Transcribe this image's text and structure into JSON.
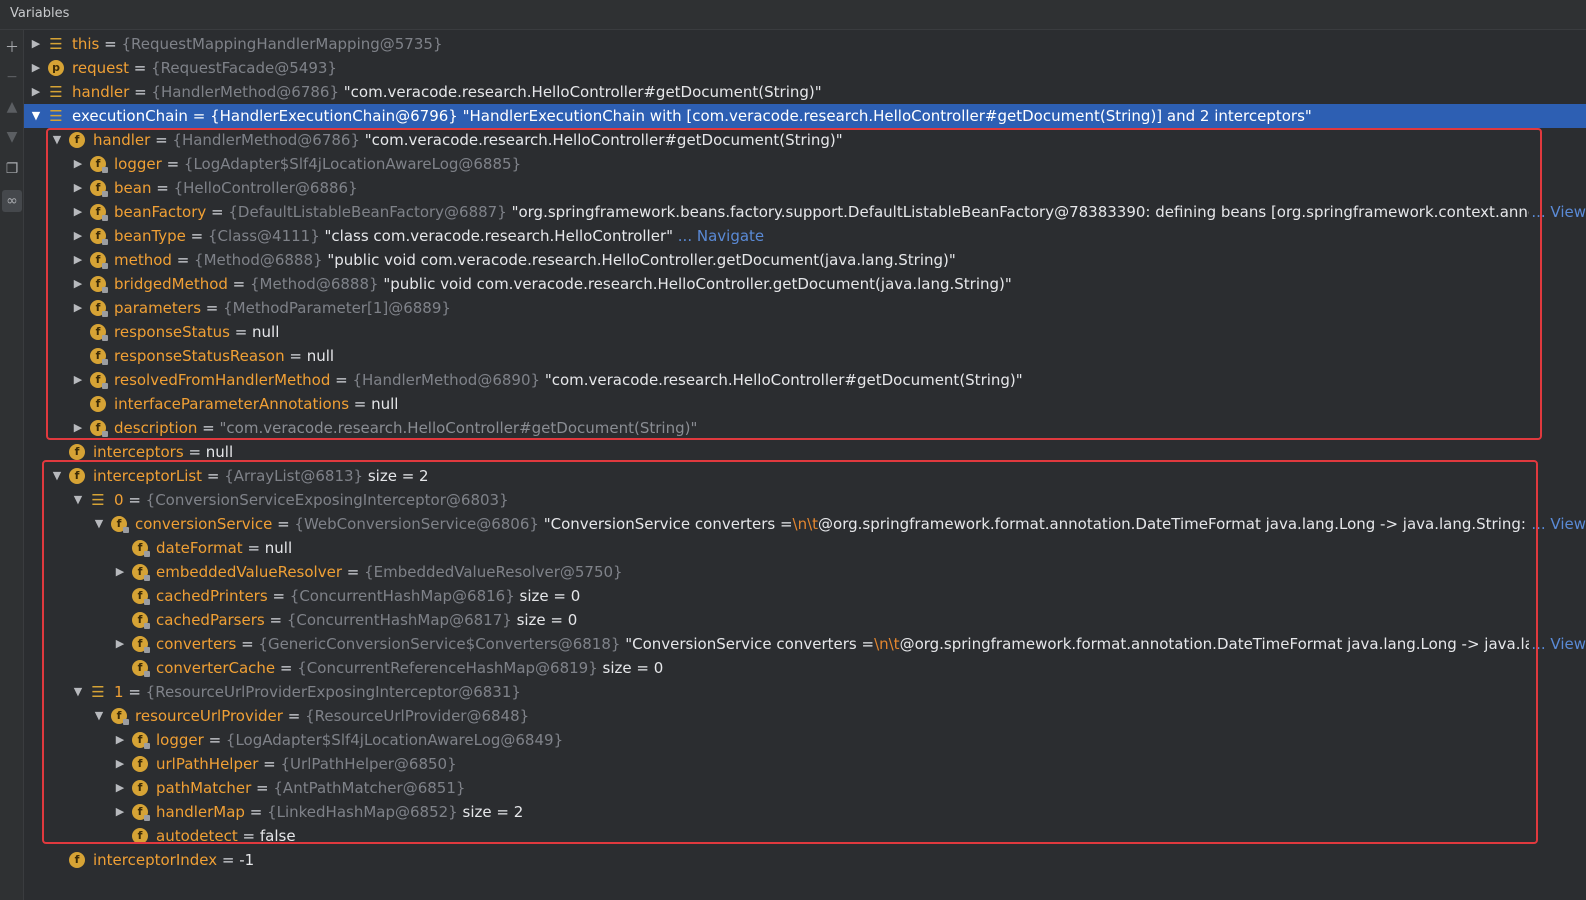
{
  "panel": {
    "title": "Variables"
  },
  "toolbar": {
    "icons": [
      "plus-icon",
      "minus-icon",
      "up-icon",
      "down-icon",
      "copy-icon",
      "watch-glasses-icon"
    ]
  },
  "rows": [
    {
      "depth": 0,
      "exp": "collapsed",
      "icon": "stack",
      "name": "this",
      "type": "{RequestMappingHandlerMapping@5735}",
      "value": "",
      "extra": ""
    },
    {
      "depth": 0,
      "exp": "collapsed",
      "icon": "param",
      "name": "request",
      "type": "{RequestFacade@5493}",
      "value": "",
      "extra": ""
    },
    {
      "depth": 0,
      "exp": "collapsed",
      "icon": "stack",
      "name": "handler",
      "type": "{HandlerMethod@6786}",
      "value": "\"com.veracode.research.HelloController#getDocument(String)\"",
      "extra": ""
    },
    {
      "depth": 0,
      "exp": "expanded",
      "icon": "stack",
      "name": "executionChain",
      "type": "{HandlerExecutionChain@6796}",
      "value": "\"HandlerExecutionChain with [com.veracode.research.HelloController#getDocument(String)] and 2 interceptors\"",
      "extra": "",
      "selected": true
    },
    {
      "depth": 1,
      "exp": "expanded",
      "icon": "field",
      "name": "handler",
      "type": "{HandlerMethod@6786}",
      "value": "\"com.veracode.research.HelloController#getDocument(String)\"",
      "extra": ""
    },
    {
      "depth": 2,
      "exp": "collapsed",
      "icon": "field-lock",
      "name": "logger",
      "type": "{LogAdapter$Slf4jLocationAwareLog@6885}",
      "value": "",
      "extra": ""
    },
    {
      "depth": 2,
      "exp": "collapsed",
      "icon": "field-lock",
      "name": "bean",
      "type": "{HelloController@6886}",
      "value": "",
      "extra": ""
    },
    {
      "depth": 2,
      "exp": "collapsed",
      "icon": "field-lock",
      "name": "beanFactory",
      "type": "{DefaultListableBeanFactory@6887}",
      "value": "\"org.springframework.beans.factory.support.DefaultListableBeanFactory@78383390: defining beans [org.springframework.context.annc",
      "extra": "",
      "view": "... View"
    },
    {
      "depth": 2,
      "exp": "collapsed",
      "icon": "field-lock",
      "name": "beanType",
      "type": "{Class@4111}",
      "value": "\"class com.veracode.research.HelloController\"",
      "extra": "",
      "link": "... Navigate"
    },
    {
      "depth": 2,
      "exp": "collapsed",
      "icon": "field-lock",
      "name": "method",
      "type": "{Method@6888}",
      "value": "\"public void com.veracode.research.HelloController.getDocument(java.lang.String)\"",
      "extra": ""
    },
    {
      "depth": 2,
      "exp": "collapsed",
      "icon": "field-lock",
      "name": "bridgedMethod",
      "type": "{Method@6888}",
      "value": "\"public void com.veracode.research.HelloController.getDocument(java.lang.String)\"",
      "extra": ""
    },
    {
      "depth": 2,
      "exp": "collapsed",
      "icon": "field-lock",
      "name": "parameters",
      "type": "{MethodParameter[1]@6889}",
      "value": "",
      "extra": ""
    },
    {
      "depth": 2,
      "exp": "none",
      "icon": "field-lock",
      "name": "responseStatus",
      "type": "",
      "value": "null",
      "extra": ""
    },
    {
      "depth": 2,
      "exp": "none",
      "icon": "field-lock",
      "name": "responseStatusReason",
      "type": "",
      "value": "null",
      "extra": ""
    },
    {
      "depth": 2,
      "exp": "collapsed",
      "icon": "field-lock",
      "name": "resolvedFromHandlerMethod",
      "type": "{HandlerMethod@6890}",
      "value": "\"com.veracode.research.HelloController#getDocument(String)\"",
      "extra": ""
    },
    {
      "depth": 2,
      "exp": "none",
      "icon": "field",
      "name": "interfaceParameterAnnotations",
      "type": "",
      "value": "null",
      "extra": ""
    },
    {
      "depth": 2,
      "exp": "collapsed",
      "icon": "field-lock",
      "name": "description",
      "type": "",
      "value": "\"com.veracode.research.HelloController#getDocument(String)\"",
      "extra": "",
      "dimvalue": true
    },
    {
      "depth": 1,
      "exp": "none",
      "icon": "field",
      "name": "interceptors",
      "type": "",
      "value": "null",
      "extra": ""
    },
    {
      "depth": 1,
      "exp": "expanded",
      "icon": "field",
      "name": "interceptorList",
      "type": "{ArrayList@6813}",
      "value": "",
      "extra": "size = 2"
    },
    {
      "depth": 2,
      "exp": "expanded",
      "icon": "stack",
      "name": "0",
      "type": "{ConversionServiceExposingInterceptor@6803}",
      "value": "",
      "extra": ""
    },
    {
      "depth": 3,
      "exp": "expanded",
      "icon": "field-lock",
      "name": "conversionService",
      "type": "{WebConversionService@6806}",
      "value": "\"ConversionService converters =\\n\\t@org.springframework.format.annotation.DateTimeFormat java.lang.Long -> java.lang.String: or",
      "extra": "",
      "view": "... View",
      "esc": true
    },
    {
      "depth": 4,
      "exp": "none",
      "icon": "field-lock",
      "name": "dateFormat",
      "type": "",
      "value": "null",
      "extra": ""
    },
    {
      "depth": 4,
      "exp": "collapsed",
      "icon": "field-lock",
      "name": "embeddedValueResolver",
      "type": "{EmbeddedValueResolver@5750}",
      "value": "",
      "extra": ""
    },
    {
      "depth": 4,
      "exp": "none",
      "icon": "field-lock",
      "name": "cachedPrinters",
      "type": "{ConcurrentHashMap@6816}",
      "value": "",
      "extra": "size = 0"
    },
    {
      "depth": 4,
      "exp": "none",
      "icon": "field-lock",
      "name": "cachedParsers",
      "type": "{ConcurrentHashMap@6817}",
      "value": "",
      "extra": "size = 0"
    },
    {
      "depth": 4,
      "exp": "collapsed",
      "icon": "field-lock",
      "name": "converters",
      "type": "{GenericConversionService$Converters@6818}",
      "value": "\"ConversionService converters =\\n\\t@org.springframework.format.annotation.DateTimeFormat java.lang.Long -> java.lang",
      "extra": "",
      "view": "... View",
      "esc": true
    },
    {
      "depth": 4,
      "exp": "none",
      "icon": "field-lock",
      "name": "converterCache",
      "type": "{ConcurrentReferenceHashMap@6819}",
      "value": "",
      "extra": "size = 0"
    },
    {
      "depth": 2,
      "exp": "expanded",
      "icon": "stack",
      "name": "1",
      "type": "{ResourceUrlProviderExposingInterceptor@6831}",
      "value": "",
      "extra": ""
    },
    {
      "depth": 3,
      "exp": "expanded",
      "icon": "field-lock",
      "name": "resourceUrlProvider",
      "type": "{ResourceUrlProvider@6848}",
      "value": "",
      "extra": ""
    },
    {
      "depth": 4,
      "exp": "collapsed",
      "icon": "field-lock",
      "name": "logger",
      "type": "{LogAdapter$Slf4jLocationAwareLog@6849}",
      "value": "",
      "extra": ""
    },
    {
      "depth": 4,
      "exp": "collapsed",
      "icon": "field",
      "name": "urlPathHelper",
      "type": "{UrlPathHelper@6850}",
      "value": "",
      "extra": ""
    },
    {
      "depth": 4,
      "exp": "collapsed",
      "icon": "field",
      "name": "pathMatcher",
      "type": "{AntPathMatcher@6851}",
      "value": "",
      "extra": ""
    },
    {
      "depth": 4,
      "exp": "collapsed",
      "icon": "field-lock",
      "name": "handlerMap",
      "type": "{LinkedHashMap@6852}",
      "value": "",
      "extra": "size = 2"
    },
    {
      "depth": 4,
      "exp": "none",
      "icon": "field",
      "name": "autodetect",
      "type": "",
      "value": "false",
      "extra": ""
    },
    {
      "depth": 1,
      "exp": "none",
      "icon": "field",
      "name": "interceptorIndex",
      "type": "",
      "value": "-1",
      "extra": ""
    }
  ],
  "colors": {
    "highlight_box": "#e0393e",
    "selection": "#2d5fb3",
    "field_name": "#f0a035"
  }
}
